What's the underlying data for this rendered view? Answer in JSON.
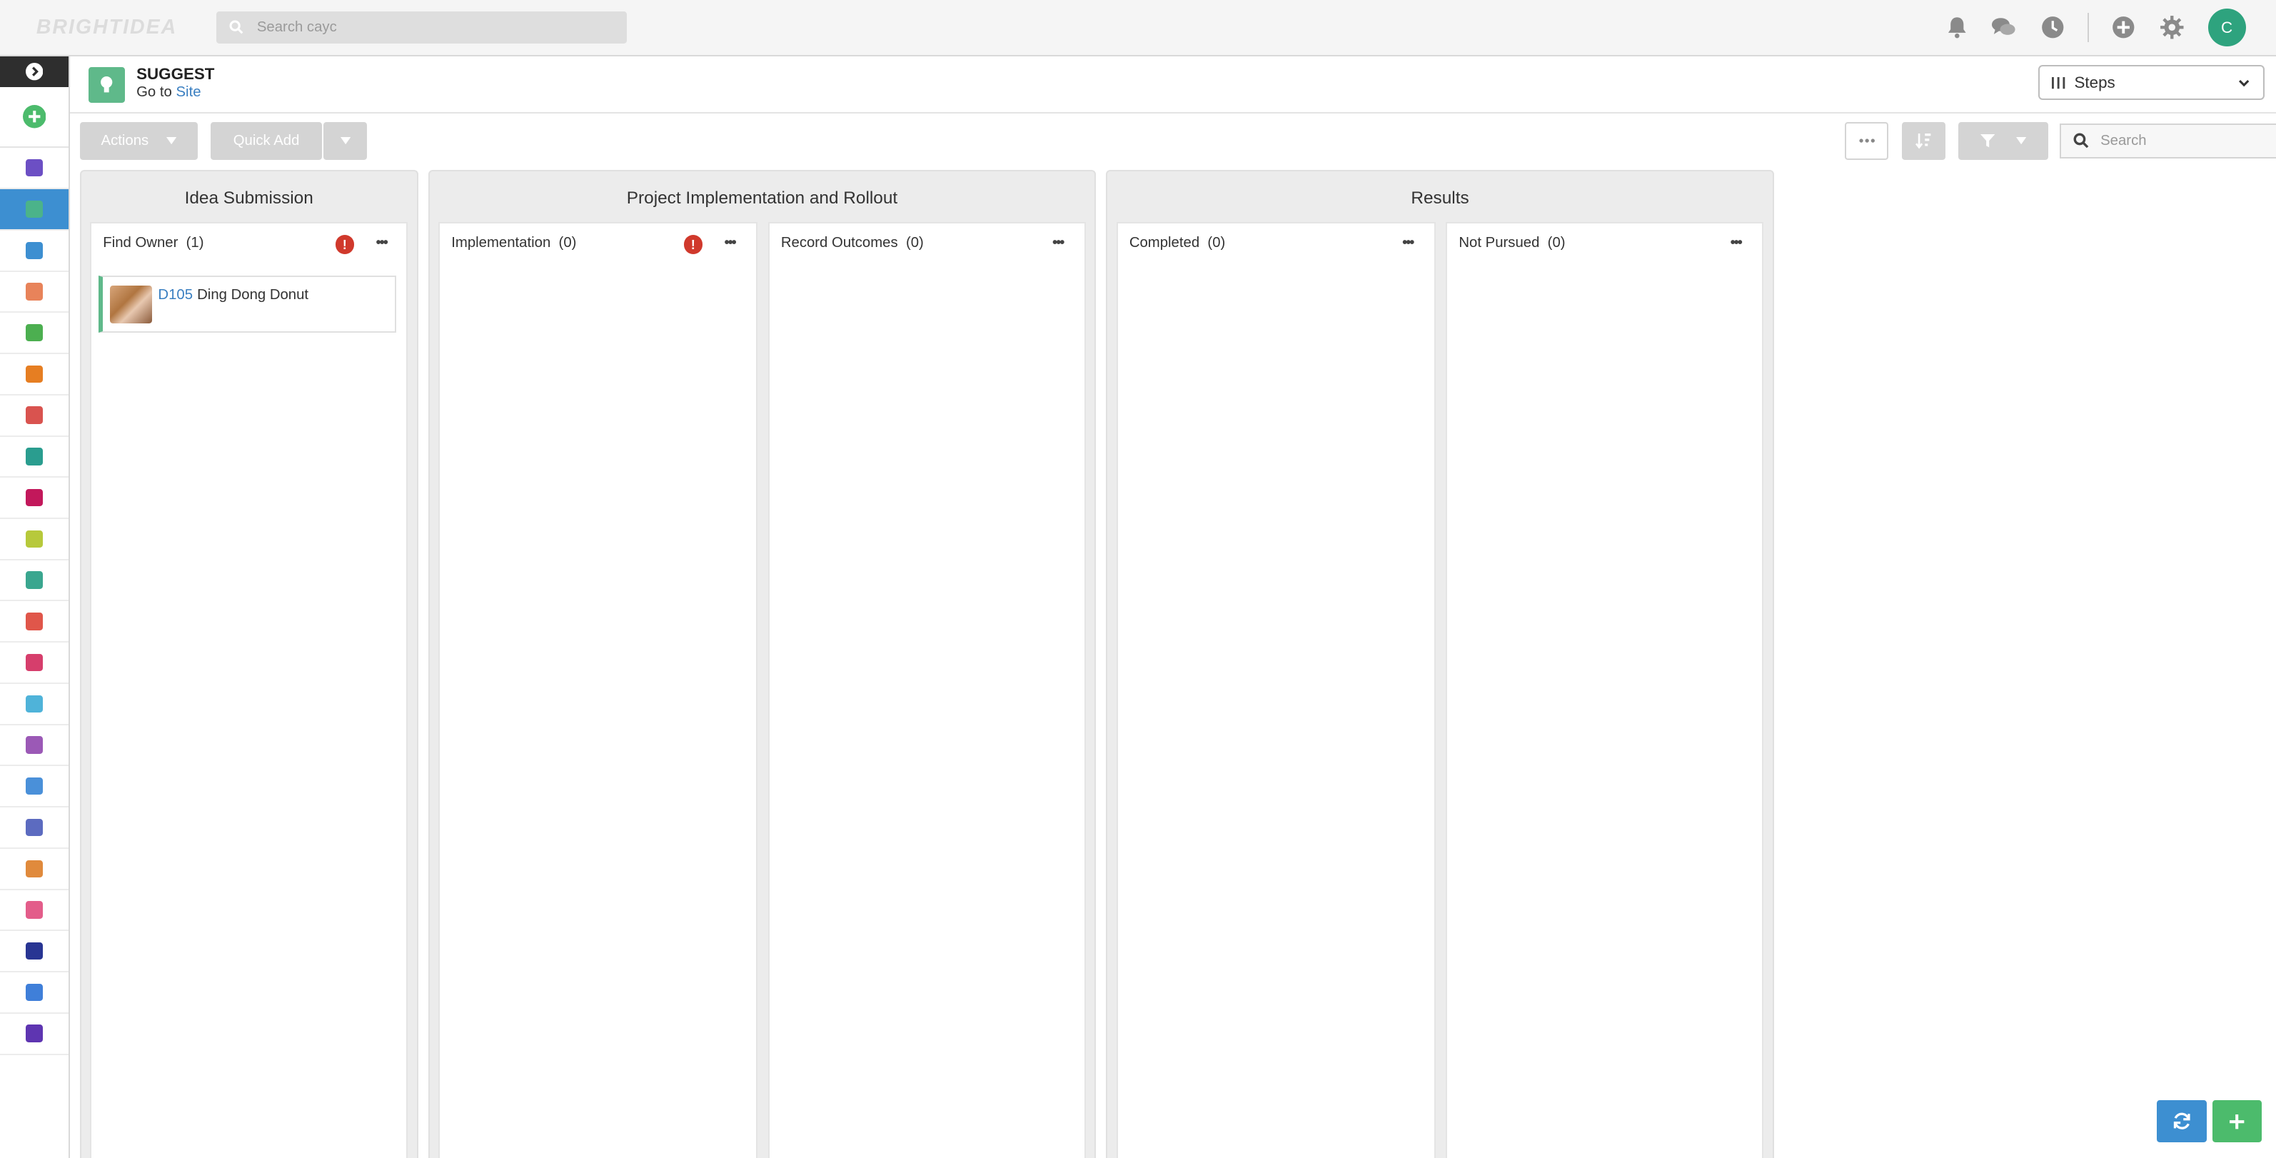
{
  "topbar": {
    "logo": "BRIGHTIDEA",
    "search_placeholder": "Search cayc",
    "icons": [
      "bell-icon",
      "chat-icon",
      "clock-icon",
      "plus-circle-icon",
      "gear-icon"
    ],
    "avatar_initial": "C"
  },
  "header": {
    "app_title": "SUGGEST",
    "goto_prefix": "Go to",
    "goto_link": "Site",
    "view_selector": "Steps"
  },
  "toolbar": {
    "actions_label": "Actions",
    "quick_add_label": "Quick Add",
    "search_placeholder": "Search"
  },
  "sidebar": {
    "item_colors": [
      "#6c4fc4",
      "#4bb38a",
      "#3d8fd1",
      "#e8835a",
      "#4caf50",
      "#e67e22",
      "#d9534f",
      "#2a9d8f",
      "#c2185b",
      "#b7c93b",
      "#3aa68f",
      "#e0564a",
      "#d63e6c",
      "#4fb3d9",
      "#9b59b6",
      "#4a90d9",
      "#5c6bc0",
      "#e08a3c",
      "#e35d8a",
      "#283593",
      "#3f7fd9",
      "#5e35b1"
    ]
  },
  "board": {
    "groups": [
      {
        "title": "Idea Submission"
      },
      {
        "title": "Project Implementation and Rollout"
      },
      {
        "title": "Results"
      }
    ],
    "columns": [
      {
        "title": "Find Owner",
        "count": "(1)"
      },
      {
        "title": "Implementation",
        "count": "(0)"
      },
      {
        "title": "Record Outcomes",
        "count": "(0)"
      },
      {
        "title": "Completed",
        "count": "(0)"
      },
      {
        "title": "Not Pursued",
        "count": "(0)"
      }
    ],
    "card": {
      "id": "D105",
      "title": "Ding Dong Donut"
    }
  }
}
